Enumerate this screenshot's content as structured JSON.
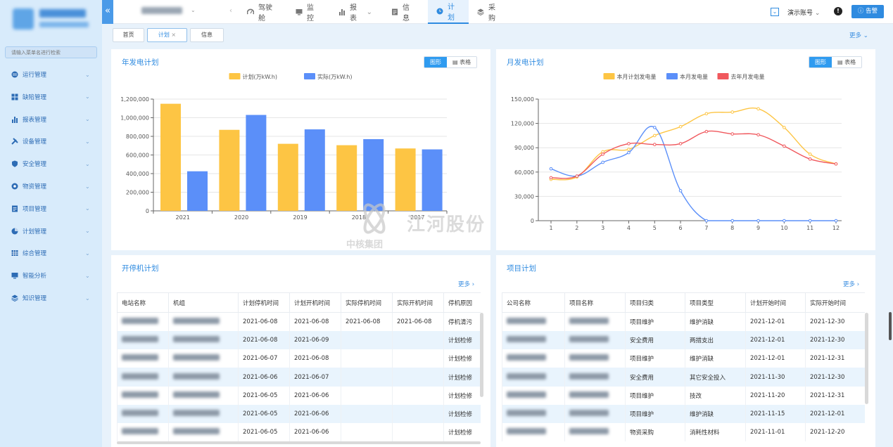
{
  "sidebar": {
    "search_placeholder": "请输入菜单名进行检索",
    "items": [
      {
        "label": "运行管理",
        "icon": "globe-icon"
      },
      {
        "label": "缺陷管理",
        "icon": "grid-icon"
      },
      {
        "label": "报表管理",
        "icon": "bar-chart-icon"
      },
      {
        "label": "设备管理",
        "icon": "tools-icon"
      },
      {
        "label": "安全管理",
        "icon": "shield-icon"
      },
      {
        "label": "物资管理",
        "icon": "cube-icon"
      },
      {
        "label": "项目管理",
        "icon": "doc-icon"
      },
      {
        "label": "计划管理",
        "icon": "pie-icon"
      },
      {
        "label": "综合管理",
        "icon": "table-icon"
      },
      {
        "label": "智能分析",
        "icon": "monitor-icon"
      },
      {
        "label": "知识管理",
        "icon": "layers-icon"
      }
    ]
  },
  "topnav": {
    "tabs": [
      {
        "label": "驾驶舱",
        "icon": "gauge-icon"
      },
      {
        "label": "监控",
        "icon": "monitor-icon"
      },
      {
        "label": "报表",
        "icon": "bar-chart-icon",
        "chevron": "⌄"
      },
      {
        "label": "信息",
        "icon": "doc-icon"
      },
      {
        "label": "计划",
        "icon": "clock-icon"
      },
      {
        "label": "采购",
        "icon": "layers-icon"
      }
    ],
    "active_tab": "计划",
    "account": "演示账号",
    "alarm_label": "告警"
  },
  "pagetabs": {
    "home": "首页",
    "plan": "计划",
    "info": "信息",
    "close": "×",
    "more": "更多"
  },
  "annual_panel": {
    "title": "年发电计划",
    "toggle_chart": "图形",
    "toggle_table": "表格"
  },
  "monthly_panel": {
    "title": "月发电计划",
    "toggle_chart": "图形",
    "toggle_table": "表格"
  },
  "startstop_panel": {
    "title": "开停机计划",
    "more": "更多",
    "columns": [
      "电站名称",
      "机组",
      "计划停机时间",
      "计划开机时间",
      "实际停机时间",
      "实际开机时间",
      "停机原因"
    ],
    "rows": [
      [
        "",
        "",
        "2021-06-08",
        "2021-06-08",
        "2021-06-08",
        "2021-06-08",
        "停机清污"
      ],
      [
        "",
        "",
        "2021-06-08",
        "2021-06-09",
        "",
        "",
        "计划检修"
      ],
      [
        "",
        "",
        "2021-06-07",
        "2021-06-08",
        "",
        "",
        "计划检修"
      ],
      [
        "",
        "",
        "2021-06-06",
        "2021-06-07",
        "",
        "",
        "计划检修"
      ],
      [
        "",
        "",
        "2021-06-05",
        "2021-06-06",
        "",
        "",
        "计划检修"
      ],
      [
        "",
        "",
        "2021-06-05",
        "2021-06-06",
        "",
        "",
        "计划检修"
      ],
      [
        "",
        "",
        "2021-06-05",
        "2021-06-06",
        "",
        "",
        "计划检修"
      ]
    ]
  },
  "project_panel": {
    "title": "项目计划",
    "more": "更多",
    "columns": [
      "公司名称",
      "项目名称",
      "项目归类",
      "项目类型",
      "计划开始时间",
      "实际开始时间"
    ],
    "rows": [
      [
        "",
        "",
        "项目维护",
        "维护消缺",
        "2021-12-01",
        "2021-12-30"
      ],
      [
        "",
        "",
        "安全费用",
        "两措支出",
        "2021-12-01",
        "2021-12-30"
      ],
      [
        "",
        "",
        "项目维护",
        "维护消缺",
        "2021-12-01",
        "2021-12-31"
      ],
      [
        "",
        "",
        "安全费用",
        "其它安全投入",
        "2021-11-30",
        "2021-12-30"
      ],
      [
        "",
        "",
        "项目维护",
        "技改",
        "2021-11-20",
        "2021-12-31"
      ],
      [
        "",
        "",
        "项目维护",
        "维护消缺",
        "2021-11-15",
        "2021-12-01"
      ],
      [
        "",
        "",
        "物资采购",
        "消耗性材料",
        "2021-11-01",
        "2021-12-20"
      ]
    ]
  },
  "watermark": {
    "text": "江河股份",
    "sub": "中核集团"
  },
  "colors": {
    "accent": "#2f8be0",
    "plan": "#fdc544",
    "actual": "#5b8ff9",
    "last_year": "#f0585d",
    "sidebar_bg": "#d8ebfb",
    "row_alt": "#e9f4fd"
  },
  "chart_data": [
    {
      "type": "bar",
      "categories": [
        "2021",
        "2020",
        "2019",
        "2018",
        "2017"
      ],
      "series": [
        {
          "name": "计划(万kW.h)",
          "values": [
            1150000,
            870000,
            720000,
            705000,
            670000
          ]
        },
        {
          "name": "实际(万kW.h)",
          "values": [
            425000,
            1030000,
            875000,
            770000,
            660000
          ]
        }
      ],
      "ylim": [
        0,
        1200000
      ],
      "yticks": [
        "0",
        "200,000",
        "400,000",
        "600,000",
        "800,000",
        "1,000,000",
        "1,200,000"
      ],
      "grid": true,
      "legend": "top-center"
    },
    {
      "type": "line",
      "x": [
        "1",
        "2",
        "3",
        "4",
        "5",
        "6",
        "7",
        "8",
        "9",
        "10",
        "11",
        "12"
      ],
      "series": [
        {
          "name": "本月计划发电量",
          "values": [
            51000,
            54000,
            85000,
            88000,
            105000,
            116000,
            132000,
            134000,
            138000,
            115000,
            82000,
            70000
          ]
        },
        {
          "name": "本月发电量",
          "values": [
            64000,
            55000,
            72000,
            84000,
            115000,
            37000,
            0,
            0,
            0,
            0,
            0,
            0
          ]
        },
        {
          "name": "去年月发电量",
          "values": [
            53000,
            55000,
            82000,
            95000,
            94000,
            95000,
            110000,
            107000,
            106000,
            92000,
            76000,
            70000
          ]
        }
      ],
      "ylim": [
        0,
        150000
      ],
      "yticks": [
        "0",
        "30,000",
        "60,000",
        "90,000",
        "120,000",
        "150,000"
      ],
      "grid": true,
      "legend": "top-center"
    }
  ]
}
